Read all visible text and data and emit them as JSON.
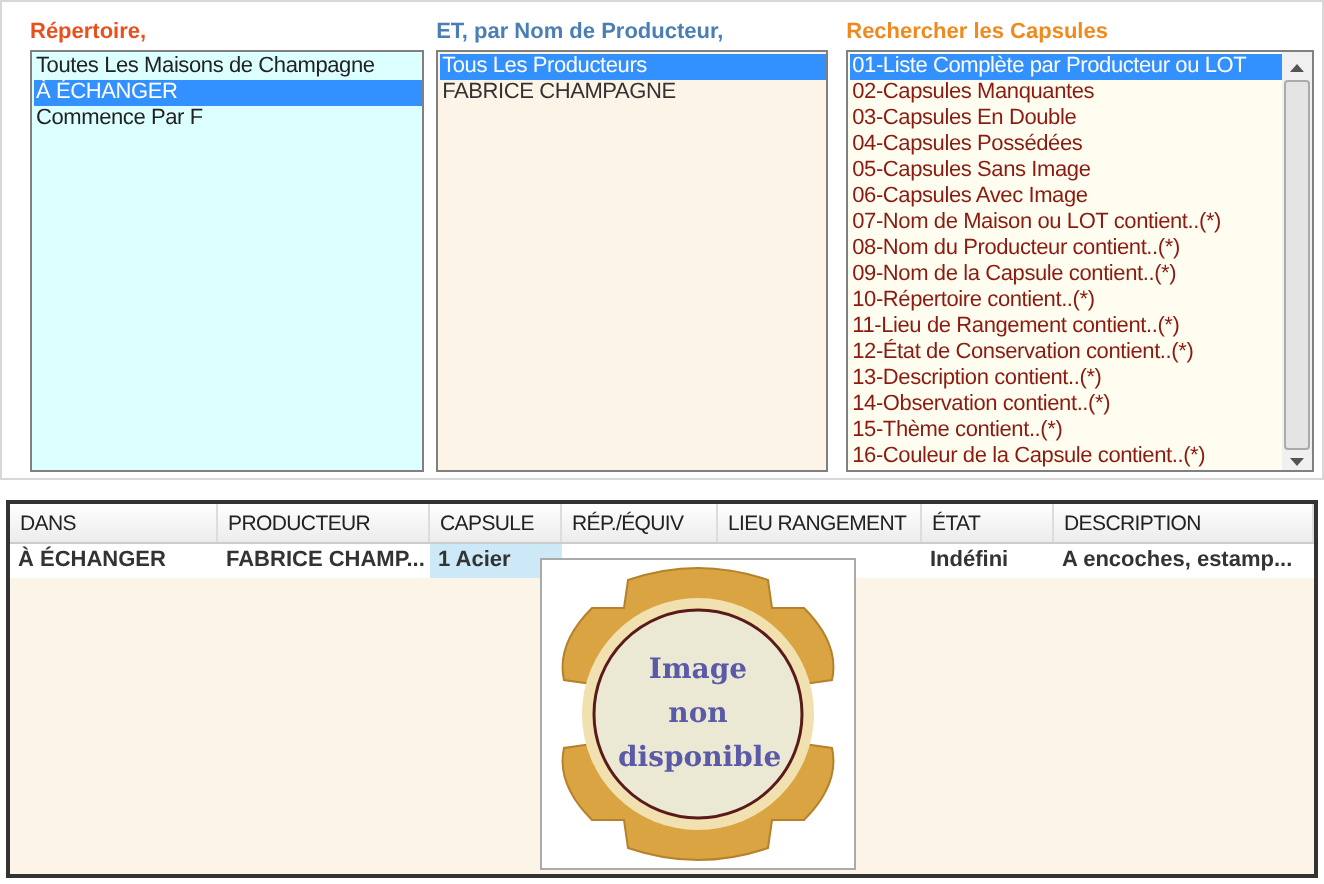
{
  "filters": [
    {
      "title": "Répertoire,",
      "kind": "repertoire",
      "items": [
        {
          "label": "Toutes Les Maisons de Champagne",
          "selected": false
        },
        {
          "label": "À ÉCHANGER",
          "selected": true
        },
        {
          "label": "Commence Par F",
          "selected": false
        }
      ]
    },
    {
      "title": "ET, par Nom de Producteur,",
      "kind": "producteur",
      "items": [
        {
          "label": "Tous Les Producteurs",
          "selected": true
        },
        {
          "label": "FABRICE CHAMPAGNE",
          "selected": false
        }
      ]
    },
    {
      "title": "Rechercher les Capsules",
      "kind": "recherche",
      "items": [
        {
          "label": "01-Liste Complète par Producteur ou LOT",
          "selected": true
        },
        {
          "label": "02-Capsules Manquantes",
          "selected": false
        },
        {
          "label": "03-Capsules En Double",
          "selected": false
        },
        {
          "label": "04-Capsules Possédées",
          "selected": false
        },
        {
          "label": "05-Capsules Sans Image",
          "selected": false
        },
        {
          "label": "06-Capsules Avec Image",
          "selected": false
        },
        {
          "label": "07-Nom de Maison ou LOT contient..(*)",
          "selected": false
        },
        {
          "label": "08-Nom du Producteur contient..(*)",
          "selected": false
        },
        {
          "label": "09-Nom de la Capsule contient..(*)",
          "selected": false
        },
        {
          "label": "10-Répertoire contient..(*)",
          "selected": false
        },
        {
          "label": "11-Lieu de Rangement contient..(*)",
          "selected": false
        },
        {
          "label": "12-État de Conservation contient..(*)",
          "selected": false
        },
        {
          "label": "13-Description contient..(*)",
          "selected": false
        },
        {
          "label": "14-Observation contient..(*)",
          "selected": false
        },
        {
          "label": "15-Thème contient..(*)",
          "selected": false
        },
        {
          "label": "16-Couleur de la Capsule contient..(*)",
          "selected": false
        }
      ]
    }
  ],
  "table": {
    "columns": [
      "DANS",
      "PRODUCTEUR",
      "CAPSULE",
      "RÉP./ÉQUIV",
      "LIEU RANGEMENT",
      "ÉTAT",
      "DESCRIPTION"
    ],
    "rows": [
      {
        "cells": [
          {
            "text": "À ÉCHANGER",
            "selected": false
          },
          {
            "text": "FABRICE CHAMP...",
            "selected": false
          },
          {
            "text": "1 Acier",
            "selected": true
          },
          {
            "text": "",
            "selected": false
          },
          {
            "text": "",
            "selected": false
          },
          {
            "text": "Indéfini",
            "selected": false
          },
          {
            "text": "A encoches, estamp...",
            "selected": false
          }
        ]
      }
    ]
  },
  "image_preview": {
    "text": "Image non disponible"
  }
}
